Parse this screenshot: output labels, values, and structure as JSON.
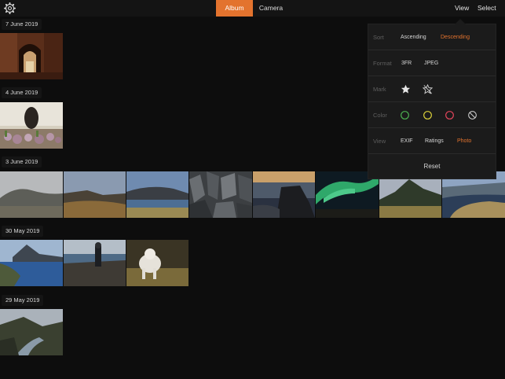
{
  "topbar": {
    "tabs": [
      "Album",
      "Camera"
    ],
    "view_label": "View",
    "select_label": "Select"
  },
  "sections": [
    {
      "date": "7 June 2019"
    },
    {
      "date": "4 June 2019"
    },
    {
      "date": "3 June 2019"
    },
    {
      "date": "30 May 2019"
    },
    {
      "date": "29 May 2019"
    }
  ],
  "popover": {
    "sort": {
      "label": "Sort",
      "options": [
        "Ascending",
        "Descending"
      ],
      "selected": "Descending"
    },
    "format": {
      "label": "Format",
      "options": [
        "3FR",
        "JPEG"
      ]
    },
    "mark": {
      "label": "Mark",
      "icons": [
        "star-icon",
        "star-off-icon"
      ]
    },
    "color": {
      "label": "Color",
      "swatches": [
        "#4caf50",
        "#d9cf3a",
        "#e0445a"
      ],
      "none_icon": "color-none-icon"
    },
    "view": {
      "label": "View",
      "options": [
        "EXIF",
        "Ratings",
        "Photo"
      ],
      "selected": "Photo"
    },
    "reset_label": "Reset"
  },
  "colors": {
    "accent": "#e3732e",
    "background": "#0d0d0d"
  }
}
